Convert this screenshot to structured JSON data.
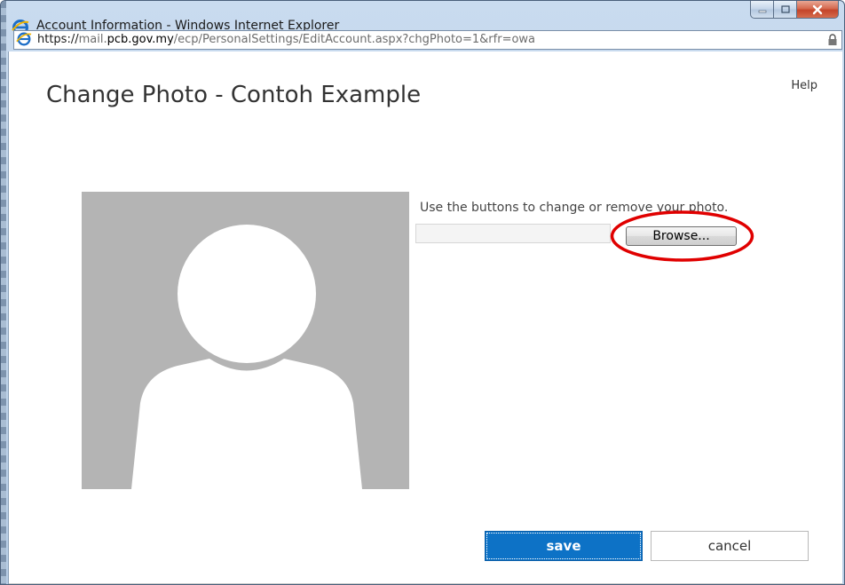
{
  "window": {
    "title": "Account Information - Windows Internet Explorer",
    "controls": {
      "minimize": "minimize",
      "maximize": "maximize",
      "close": "close"
    }
  },
  "address_bar": {
    "protocol": "https://",
    "host_prefix": "mail.",
    "host_domain": "pcb.gov.my",
    "path": "/ecp/PersonalSettings/EditAccount.aspx?chgPhoto=1&rfr=owa"
  },
  "page": {
    "title": "Change Photo - Contoh Example",
    "help_label": "Help",
    "instruction": "Use the buttons to change or remove your photo.",
    "file_input_value": "",
    "browse_label": "Browse...",
    "save_label": "save",
    "cancel_label": "cancel"
  },
  "colors": {
    "accent": "#0d72c6",
    "highlight": "#e00000",
    "placeholder_bg": "#b4b4b4"
  },
  "icons": {
    "browser": "ie-logo-icon",
    "lock": "lock-icon",
    "avatar": "person-silhouette-icon"
  }
}
